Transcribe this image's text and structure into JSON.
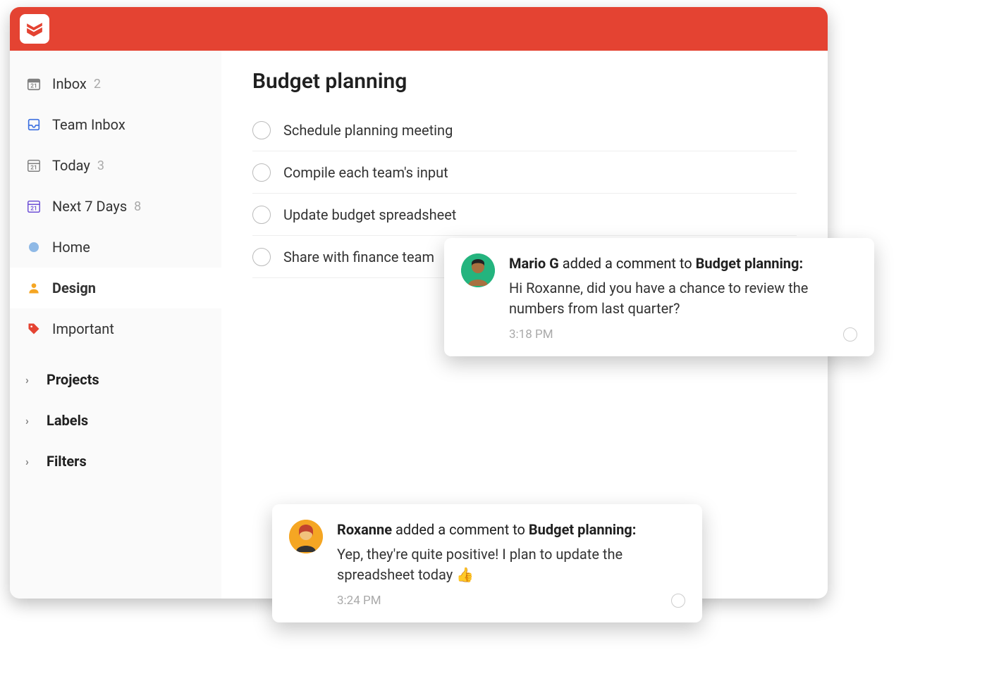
{
  "sidebar": {
    "items": [
      {
        "label": "Inbox",
        "count": "2"
      },
      {
        "label": "Team Inbox"
      },
      {
        "label": "Today",
        "count": "3",
        "day": "21"
      },
      {
        "label": "Next 7 Days",
        "count": "8",
        "day": "21"
      },
      {
        "label": "Home",
        "dot_color": "#8fb9e6"
      },
      {
        "label": "Design"
      },
      {
        "label": "Important"
      }
    ],
    "sections": [
      {
        "label": "Projects"
      },
      {
        "label": "Labels"
      },
      {
        "label": "Filters"
      }
    ],
    "inbox_day": "21"
  },
  "main": {
    "project_title": "Budget planning",
    "tasks": [
      {
        "label": "Schedule planning meeting"
      },
      {
        "label": "Compile each team's input"
      },
      {
        "label": "Update budget spreadsheet"
      },
      {
        "label": "Share with finance team"
      }
    ]
  },
  "notifications": [
    {
      "author": "Mario G",
      "action": "added a comment to",
      "target": "Budget planning:",
      "body": "Hi Roxanne, did you have a chance to review the numbers from last quarter?",
      "time": "3:18 PM"
    },
    {
      "author": "Roxanne",
      "action": "added a comment to",
      "target": "Budget planning:",
      "body": "Yep, they're quite positive! I plan to update the spreadsheet today 👍",
      "time": "3:24 PM"
    }
  ]
}
